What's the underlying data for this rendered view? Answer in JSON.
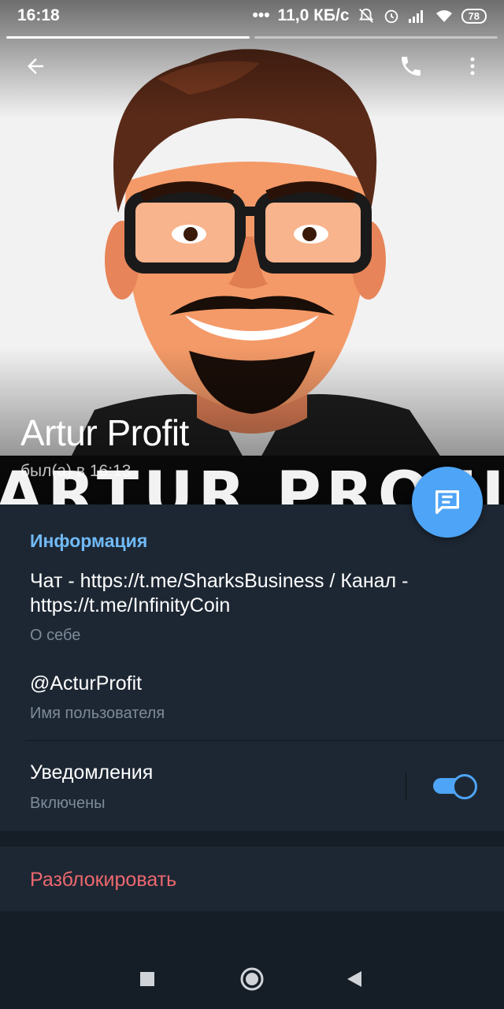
{
  "status_bar": {
    "time": "16:18",
    "network_speed": "11,0 КБ/с",
    "battery": "78",
    "icons": [
      "dots-icon",
      "mute-bell-icon",
      "alarm-icon",
      "signal-icon",
      "wifi-icon",
      "battery-icon"
    ]
  },
  "toolbar": {
    "back_icon": "arrow-left-icon",
    "call_icon": "phone-icon",
    "menu_icon": "more-vert-icon"
  },
  "profile": {
    "name": "Artur Profit",
    "last_seen": "был(а) в 16:13",
    "photo_banner_text": "ARTUR PROFIT",
    "photo_count": 2,
    "active_photo_index": 1
  },
  "info": {
    "section_title": "Информация",
    "bio_line1": "Чат - https://t.me/SharksBusiness / Канал -",
    "bio_line2": "https://t.me/InfinityCoin",
    "bio_label": "О себе",
    "username": "@ActurProfit",
    "username_label": "Имя пользователя",
    "notifications_title": "Уведомления",
    "notifications_state": "Включены",
    "notifications_enabled": true
  },
  "actions": {
    "unblock_label": "Разблокировать"
  },
  "colors": {
    "accent": "#4ea4f6",
    "section_title": "#71baf6",
    "danger": "#ee686f",
    "background": "#1d2733"
  }
}
